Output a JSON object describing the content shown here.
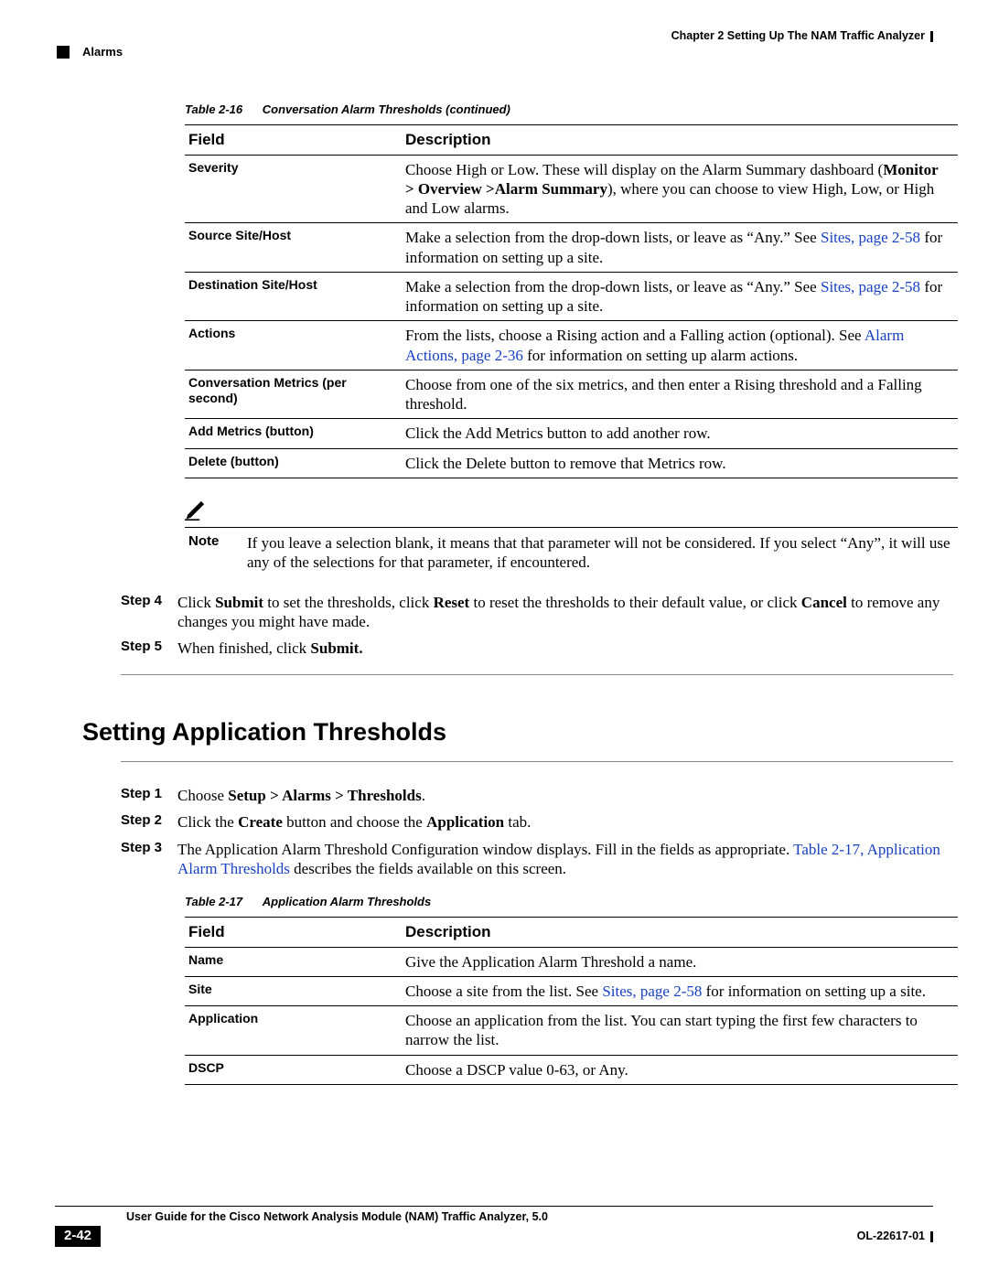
{
  "header": {
    "chapter": "Chapter 2      Setting Up The NAM Traffic Analyzer",
    "section": "Alarms"
  },
  "table16": {
    "caption_label": "Table 2-16",
    "caption_title": "Conversation Alarm Thresholds (continued)",
    "col_field": "Field",
    "col_desc": "Description",
    "rows": {
      "severity": {
        "f": "Severity",
        "d_pre": "Choose High or Low. These will display on the Alarm Summary dashboard (",
        "d_bold": "Monitor > Overview >Alarm Summary",
        "d_post": "), where you can choose to view High, Low, or High and Low alarms."
      },
      "srcsite": {
        "f": "Source Site/Host",
        "d_pre": "Make a selection from the drop-down lists, or leave as “Any.” See ",
        "d_link": "Sites, page 2-58",
        "d_post": " for information on setting up a site."
      },
      "dstsite": {
        "f": "Destination Site/Host",
        "d_pre": "Make a selection from the drop-down lists, or leave as “Any.” See ",
        "d_link": "Sites, page 2-58",
        "d_post": " for information on setting up a site."
      },
      "actions": {
        "f": "Actions",
        "d_pre": "From the lists, choose a Rising action and a Falling action (optional). See ",
        "d_link": "Alarm Actions, page 2-36",
        "d_post": " for information on setting up alarm actions."
      },
      "metrics": {
        "f": "Conversation Metrics (per second)",
        "d": "Choose from one of the six metrics, and then enter a Rising threshold and a Falling threshold."
      },
      "addbtn": {
        "f": "Add Metrics (button)",
        "d": "Click the Add Metrics button to add another row."
      },
      "delbtn": {
        "f": "Delete (button)",
        "d": "Click the Delete button to remove that Metrics row."
      }
    }
  },
  "note": {
    "label": "Note",
    "text": "If you leave a selection blank, it means that that parameter will not be considered. If you select “Any”, it will use any of the selections for that parameter, if encountered."
  },
  "steps_a": {
    "s4": {
      "lbl": "Step 4",
      "p1": "Click ",
      "b1": "Submit",
      "p2": " to set the thresholds, click ",
      "b2": "Reset",
      "p3": " to reset the thresholds to their default value, or click ",
      "b3": "Cancel",
      "p4": " to remove any changes you might have made."
    },
    "s5": {
      "lbl": "Step 5",
      "p1": "When finished, click ",
      "b1": "Submit.",
      "p2": ""
    }
  },
  "section_heading": "Setting Application Thresholds",
  "steps_b": {
    "s1": {
      "lbl": "Step 1",
      "p1": "Choose ",
      "b1": "Setup > Alarms > Thresholds",
      "p2": "."
    },
    "s2": {
      "lbl": "Step 2",
      "p1": "Click the ",
      "b1": "Create",
      "p2": " button and choose the ",
      "b2": "Application",
      "p3": " tab."
    },
    "s3": {
      "lbl": "Step 3",
      "p1": "The Application Alarm Threshold Configuration window displays. Fill in the fields as appropriate. ",
      "link": "Table 2-17, Application Alarm Thresholds",
      "p2": " describes the fields available on this screen."
    }
  },
  "table17": {
    "caption_label": "Table 2-17",
    "caption_title": "Application Alarm Thresholds",
    "col_field": "Field",
    "col_desc": "Description",
    "rows": {
      "name": {
        "f": "Name",
        "d": "Give the Application Alarm Threshold a name."
      },
      "site": {
        "f": "Site",
        "d_pre": "Choose a site from the list. See ",
        "d_link": "Sites, page 2-58",
        "d_post": " for information on setting up a site."
      },
      "app": {
        "f": "Application",
        "d": "Choose an application from the list. You can start typing the first few characters to narrow the list."
      },
      "dscp": {
        "f": "DSCP",
        "d": "Choose a DSCP value 0-63, or Any."
      }
    }
  },
  "footer": {
    "title": "User Guide for the Cisco Network Analysis Module (NAM) Traffic Analyzer, 5.0",
    "page": "2-42",
    "docnum": "OL-22617-01"
  }
}
